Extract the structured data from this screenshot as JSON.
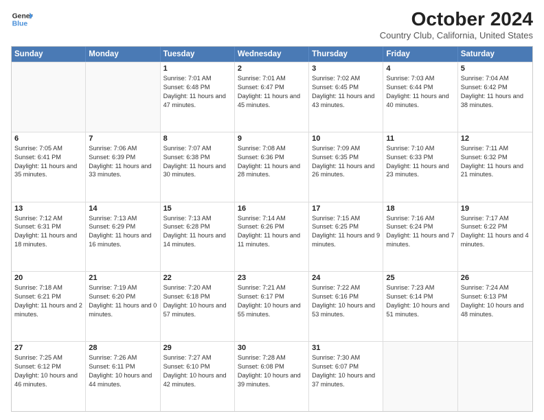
{
  "header": {
    "logo_line1": "General",
    "logo_line2": "Blue",
    "title": "October 2024",
    "subtitle": "Country Club, California, United States"
  },
  "weekdays": [
    "Sunday",
    "Monday",
    "Tuesday",
    "Wednesday",
    "Thursday",
    "Friday",
    "Saturday"
  ],
  "weeks": [
    [
      {
        "day": "",
        "sunrise": "",
        "sunset": "",
        "daylight": ""
      },
      {
        "day": "",
        "sunrise": "",
        "sunset": "",
        "daylight": ""
      },
      {
        "day": "1",
        "sunrise": "Sunrise: 7:01 AM",
        "sunset": "Sunset: 6:48 PM",
        "daylight": "Daylight: 11 hours and 47 minutes."
      },
      {
        "day": "2",
        "sunrise": "Sunrise: 7:01 AM",
        "sunset": "Sunset: 6:47 PM",
        "daylight": "Daylight: 11 hours and 45 minutes."
      },
      {
        "day": "3",
        "sunrise": "Sunrise: 7:02 AM",
        "sunset": "Sunset: 6:45 PM",
        "daylight": "Daylight: 11 hours and 43 minutes."
      },
      {
        "day": "4",
        "sunrise": "Sunrise: 7:03 AM",
        "sunset": "Sunset: 6:44 PM",
        "daylight": "Daylight: 11 hours and 40 minutes."
      },
      {
        "day": "5",
        "sunrise": "Sunrise: 7:04 AM",
        "sunset": "Sunset: 6:42 PM",
        "daylight": "Daylight: 11 hours and 38 minutes."
      }
    ],
    [
      {
        "day": "6",
        "sunrise": "Sunrise: 7:05 AM",
        "sunset": "Sunset: 6:41 PM",
        "daylight": "Daylight: 11 hours and 35 minutes."
      },
      {
        "day": "7",
        "sunrise": "Sunrise: 7:06 AM",
        "sunset": "Sunset: 6:39 PM",
        "daylight": "Daylight: 11 hours and 33 minutes."
      },
      {
        "day": "8",
        "sunrise": "Sunrise: 7:07 AM",
        "sunset": "Sunset: 6:38 PM",
        "daylight": "Daylight: 11 hours and 30 minutes."
      },
      {
        "day": "9",
        "sunrise": "Sunrise: 7:08 AM",
        "sunset": "Sunset: 6:36 PM",
        "daylight": "Daylight: 11 hours and 28 minutes."
      },
      {
        "day": "10",
        "sunrise": "Sunrise: 7:09 AM",
        "sunset": "Sunset: 6:35 PM",
        "daylight": "Daylight: 11 hours and 26 minutes."
      },
      {
        "day": "11",
        "sunrise": "Sunrise: 7:10 AM",
        "sunset": "Sunset: 6:33 PM",
        "daylight": "Daylight: 11 hours and 23 minutes."
      },
      {
        "day": "12",
        "sunrise": "Sunrise: 7:11 AM",
        "sunset": "Sunset: 6:32 PM",
        "daylight": "Daylight: 11 hours and 21 minutes."
      }
    ],
    [
      {
        "day": "13",
        "sunrise": "Sunrise: 7:12 AM",
        "sunset": "Sunset: 6:31 PM",
        "daylight": "Daylight: 11 hours and 18 minutes."
      },
      {
        "day": "14",
        "sunrise": "Sunrise: 7:13 AM",
        "sunset": "Sunset: 6:29 PM",
        "daylight": "Daylight: 11 hours and 16 minutes."
      },
      {
        "day": "15",
        "sunrise": "Sunrise: 7:13 AM",
        "sunset": "Sunset: 6:28 PM",
        "daylight": "Daylight: 11 hours and 14 minutes."
      },
      {
        "day": "16",
        "sunrise": "Sunrise: 7:14 AM",
        "sunset": "Sunset: 6:26 PM",
        "daylight": "Daylight: 11 hours and 11 minutes."
      },
      {
        "day": "17",
        "sunrise": "Sunrise: 7:15 AM",
        "sunset": "Sunset: 6:25 PM",
        "daylight": "Daylight: 11 hours and 9 minutes."
      },
      {
        "day": "18",
        "sunrise": "Sunrise: 7:16 AM",
        "sunset": "Sunset: 6:24 PM",
        "daylight": "Daylight: 11 hours and 7 minutes."
      },
      {
        "day": "19",
        "sunrise": "Sunrise: 7:17 AM",
        "sunset": "Sunset: 6:22 PM",
        "daylight": "Daylight: 11 hours and 4 minutes."
      }
    ],
    [
      {
        "day": "20",
        "sunrise": "Sunrise: 7:18 AM",
        "sunset": "Sunset: 6:21 PM",
        "daylight": "Daylight: 11 hours and 2 minutes."
      },
      {
        "day": "21",
        "sunrise": "Sunrise: 7:19 AM",
        "sunset": "Sunset: 6:20 PM",
        "daylight": "Daylight: 11 hours and 0 minutes."
      },
      {
        "day": "22",
        "sunrise": "Sunrise: 7:20 AM",
        "sunset": "Sunset: 6:18 PM",
        "daylight": "Daylight: 10 hours and 57 minutes."
      },
      {
        "day": "23",
        "sunrise": "Sunrise: 7:21 AM",
        "sunset": "Sunset: 6:17 PM",
        "daylight": "Daylight: 10 hours and 55 minutes."
      },
      {
        "day": "24",
        "sunrise": "Sunrise: 7:22 AM",
        "sunset": "Sunset: 6:16 PM",
        "daylight": "Daylight: 10 hours and 53 minutes."
      },
      {
        "day": "25",
        "sunrise": "Sunrise: 7:23 AM",
        "sunset": "Sunset: 6:14 PM",
        "daylight": "Daylight: 10 hours and 51 minutes."
      },
      {
        "day": "26",
        "sunrise": "Sunrise: 7:24 AM",
        "sunset": "Sunset: 6:13 PM",
        "daylight": "Daylight: 10 hours and 48 minutes."
      }
    ],
    [
      {
        "day": "27",
        "sunrise": "Sunrise: 7:25 AM",
        "sunset": "Sunset: 6:12 PM",
        "daylight": "Daylight: 10 hours and 46 minutes."
      },
      {
        "day": "28",
        "sunrise": "Sunrise: 7:26 AM",
        "sunset": "Sunset: 6:11 PM",
        "daylight": "Daylight: 10 hours and 44 minutes."
      },
      {
        "day": "29",
        "sunrise": "Sunrise: 7:27 AM",
        "sunset": "Sunset: 6:10 PM",
        "daylight": "Daylight: 10 hours and 42 minutes."
      },
      {
        "day": "30",
        "sunrise": "Sunrise: 7:28 AM",
        "sunset": "Sunset: 6:08 PM",
        "daylight": "Daylight: 10 hours and 39 minutes."
      },
      {
        "day": "31",
        "sunrise": "Sunrise: 7:30 AM",
        "sunset": "Sunset: 6:07 PM",
        "daylight": "Daylight: 10 hours and 37 minutes."
      },
      {
        "day": "",
        "sunrise": "",
        "sunset": "",
        "daylight": ""
      },
      {
        "day": "",
        "sunrise": "",
        "sunset": "",
        "daylight": ""
      }
    ]
  ]
}
